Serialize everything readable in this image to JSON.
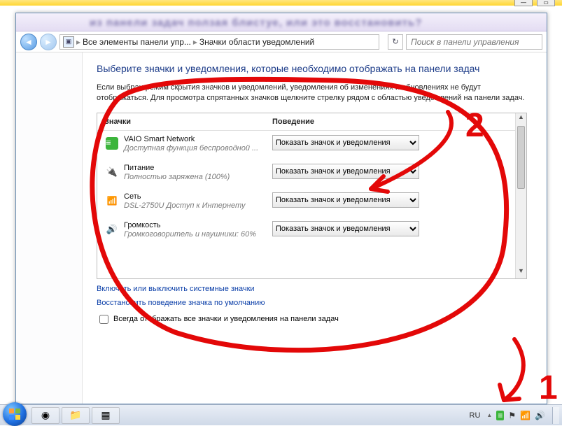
{
  "top": {
    "min": "—",
    "max": "▭"
  },
  "window": {
    "blurTitle": "из панели задач ползая блистуе, или это восстановить?"
  },
  "addressbar": {
    "crumb1": "Все элементы панели упр...",
    "crumb2": "Значки области уведомлений",
    "searchPlaceholder": "Поиск в панели управления"
  },
  "page": {
    "title": "Выберите значки и уведомления, которые необходимо отображать на панели задач",
    "description": "Если выбран режим скрытия значков и уведомлений, уведомления об изменениях и обновлениях не будут отображаться. Для просмотра спрятанных значков щелкните стрелку рядом с областью уведомлений на панели задач.",
    "colIcons": "Значки",
    "colBehavior": "Поведение",
    "optShow": "Показать значок и уведомления",
    "link1": "Включить или выключить системные значки",
    "link2": "Восстановить поведение значка по умолчанию",
    "alwaysShow": "Всегда отображать все значки и уведомления на панели задач"
  },
  "rows": [
    {
      "icon": "green",
      "name": "VAIO Smart Network",
      "sub": "Доступная функция беспроводной ..."
    },
    {
      "icon": "power",
      "name": "Питание",
      "sub": "Полностью заряжена (100%)"
    },
    {
      "icon": "net",
      "name": "Сеть",
      "sub": "DSL-2750U Доступ к Интернету"
    },
    {
      "icon": "vol",
      "name": "Громкость",
      "sub": "Громкоговоритель и наушники: 60%"
    }
  ],
  "taskbar": {
    "lang": "RU"
  },
  "annot": {
    "num1": "1",
    "num2": "2"
  }
}
